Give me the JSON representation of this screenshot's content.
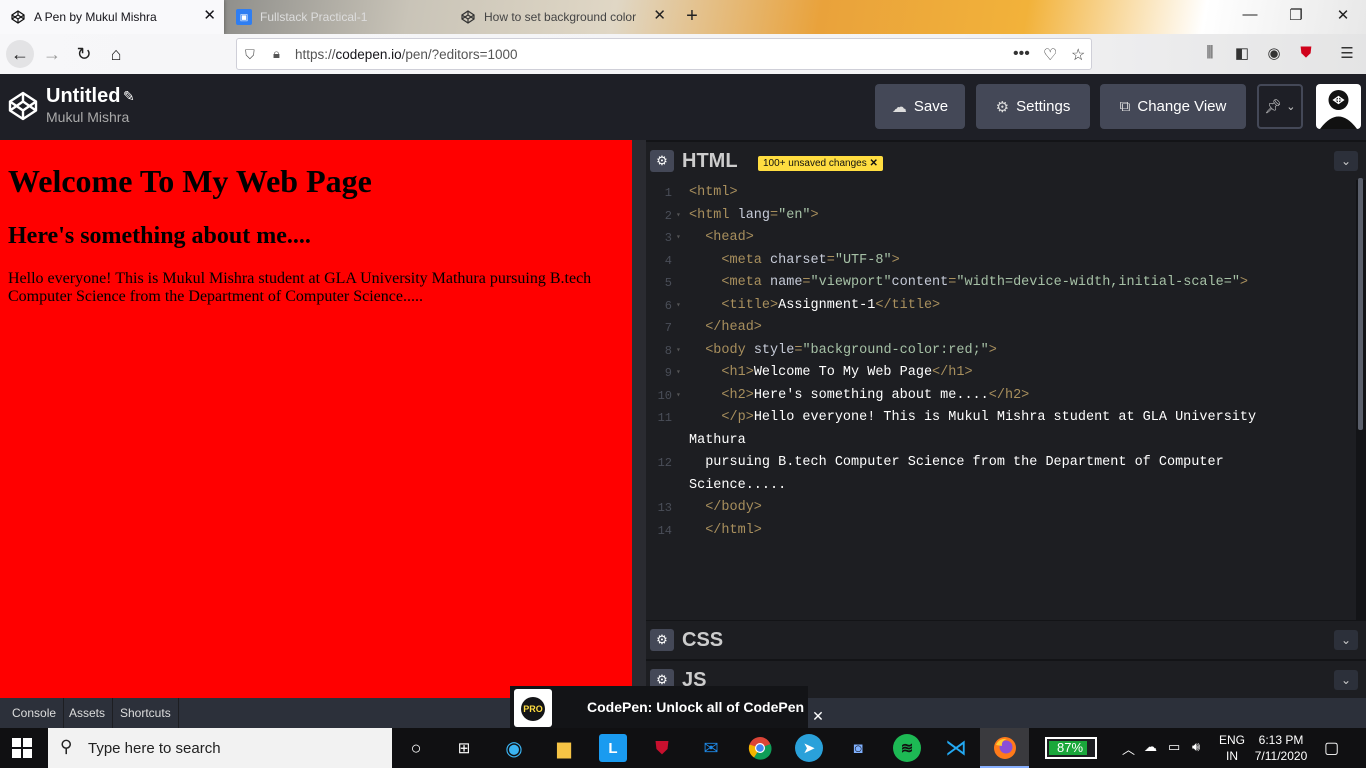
{
  "browser": {
    "tabs": [
      {
        "title": "A Pen by Mukul Mishra",
        "icon": "codepen-icon"
      },
      {
        "title": "Fullstack Practical-1",
        "icon": "classroom-icon"
      },
      {
        "title": "How to set background color",
        "icon": "codepen-icon"
      }
    ],
    "url_prefix": "https://",
    "url_domain": "codepen.io",
    "url_path": "/pen/?editors=1000"
  },
  "codepen": {
    "title": "Untitled",
    "author": "Mukul Mishra",
    "buttons": {
      "save": "Save",
      "settings": "Settings",
      "change_view": "Change View"
    }
  },
  "preview": {
    "h1": "Welcome To My Web Page",
    "h2": "Here's something about me....",
    "p": "Hello everyone! This is Mukul Mishra student at GLA University Mathura pursuing B.tech Computer Science from the Department of Computer Science.....",
    "background": "#ff0000"
  },
  "editor": {
    "html_label": "HTML",
    "unsaved_badge": "100+ unsaved changes",
    "css_label": "CSS",
    "js_label": "JS",
    "lines": [
      {
        "n": "1",
        "fold": "",
        "segments": [
          [
            "tg",
            "<html>"
          ]
        ]
      },
      {
        "n": "2",
        "fold": "▾",
        "segments": [
          [
            "tg",
            "<html "
          ],
          [
            "at",
            "lang"
          ],
          [
            "tg",
            "="
          ],
          [
            "st",
            "\"en\""
          ],
          [
            "tg",
            ">"
          ]
        ]
      },
      {
        "n": "3",
        "fold": "▾",
        "segments": [
          [
            "tx",
            "  "
          ],
          [
            "tg",
            "<head>"
          ]
        ]
      },
      {
        "n": "4",
        "fold": "",
        "segments": [
          [
            "tx",
            "    "
          ],
          [
            "tg",
            "<meta "
          ],
          [
            "at",
            "charset"
          ],
          [
            "tg",
            "="
          ],
          [
            "st",
            "\"UTF-8\""
          ],
          [
            "tg",
            ">"
          ]
        ]
      },
      {
        "n": "5",
        "fold": "",
        "segments": [
          [
            "tx",
            "    "
          ],
          [
            "tg",
            "<meta "
          ],
          [
            "at",
            "name"
          ],
          [
            "tg",
            "="
          ],
          [
            "st",
            "\"viewport\""
          ],
          [
            "at",
            "content"
          ],
          [
            "tg",
            "="
          ],
          [
            "st",
            "\"width=device-width,initial-scale=\""
          ],
          [
            "tg",
            ">"
          ]
        ]
      },
      {
        "n": "6",
        "fold": "▾",
        "segments": [
          [
            "tx",
            "    "
          ],
          [
            "tg",
            "<title>"
          ],
          [
            "tx",
            "Assignment-1"
          ],
          [
            "tg",
            "</title>"
          ]
        ]
      },
      {
        "n": "7",
        "fold": "",
        "segments": [
          [
            "tx",
            "  "
          ],
          [
            "tg",
            "</head>"
          ]
        ]
      },
      {
        "n": "8",
        "fold": "▾",
        "segments": [
          [
            "tx",
            "  "
          ],
          [
            "tg",
            "<body "
          ],
          [
            "at",
            "style"
          ],
          [
            "tg",
            "="
          ],
          [
            "st",
            "\"background-color:red;\""
          ],
          [
            "tg",
            ">"
          ]
        ]
      },
      {
        "n": "9",
        "fold": "▾",
        "segments": [
          [
            "tx",
            "    "
          ],
          [
            "tg",
            "<h1>"
          ],
          [
            "tx",
            "Welcome To My Web Page"
          ],
          [
            "tg",
            "</h1>"
          ]
        ]
      },
      {
        "n": "10",
        "fold": "▾",
        "segments": [
          [
            "tx",
            "    "
          ],
          [
            "tg",
            "<h2>"
          ],
          [
            "tx",
            "Here's something about me...."
          ],
          [
            "tg",
            "</h2>"
          ]
        ]
      },
      {
        "n": "11",
        "fold": "",
        "segments": [
          [
            "tx",
            "    "
          ],
          [
            "tg",
            "</p>"
          ],
          [
            "tx",
            "Hello everyone! This is Mukul Mishra student at GLA University"
          ]
        ]
      },
      {
        "n": "",
        "fold": "",
        "segments": [
          [
            "tx",
            "Mathura"
          ]
        ]
      },
      {
        "n": "12",
        "fold": "",
        "segments": [
          [
            "tx",
            "  pursuing B.tech Computer Science from the Department of Computer"
          ]
        ]
      },
      {
        "n": "",
        "fold": "",
        "segments": [
          [
            "tx",
            "Science....."
          ]
        ]
      },
      {
        "n": "13",
        "fold": "",
        "segments": [
          [
            "tx",
            "  "
          ],
          [
            "tg",
            "</body>"
          ]
        ]
      },
      {
        "n": "14",
        "fold": "",
        "segments": [
          [
            "tx",
            "  "
          ],
          [
            "tg",
            "</html>"
          ]
        ]
      }
    ]
  },
  "bottom": {
    "console": "Console",
    "assets": "Assets",
    "shortcuts": "Shortcuts",
    "promo_text": "CodePen: Unlock all of CodePen",
    "promo_badge": "PRO"
  },
  "taskbar": {
    "search_placeholder": "Type here to search",
    "battery_percent": "87%",
    "battery_level": 0.87,
    "lang_line1": "ENG",
    "lang_line2": "IN",
    "time": "6:13 PM",
    "date": "7/11/2020"
  }
}
